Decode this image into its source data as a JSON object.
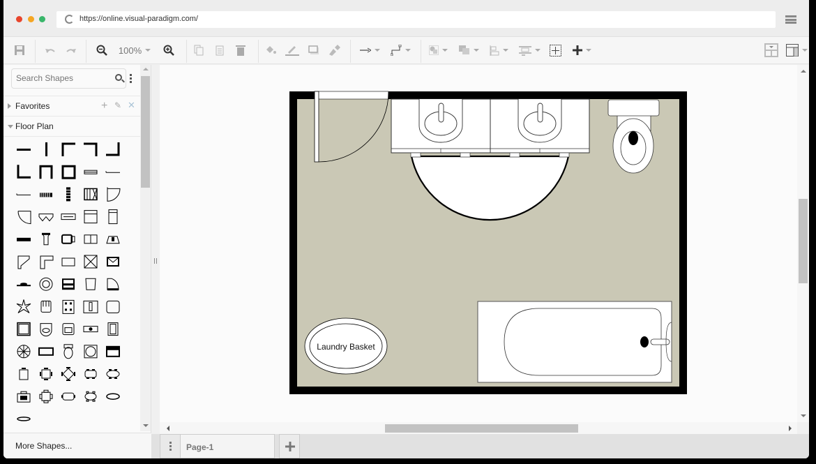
{
  "browser": {
    "url": "https://online.visual-paradigm.com/",
    "traffic_lights": {
      "close": "#e8452c",
      "minimize": "#f5a623",
      "maximize": "#39b66a"
    }
  },
  "toolbar": {
    "zoom_level": "100%",
    "buttons": [
      "save-icon",
      "undo-icon",
      "redo-icon",
      "zoom-out-icon",
      "zoom-in-icon",
      "copy-icon",
      "paste-icon",
      "delete-icon",
      "fill-color-icon",
      "line-color-icon",
      "shadow-icon",
      "format-painter-icon",
      "connector-straight-icon",
      "connector-elbow-icon",
      "arrange-icon",
      "to-front-icon",
      "align-icon",
      "distribute-icon",
      "select-all-icon",
      "insert-icon",
      "panel-layout-icon",
      "sidebar-toggle-icon"
    ]
  },
  "sidebar": {
    "search_placeholder": "Search Shapes",
    "sections": [
      {
        "label": "Favorites",
        "expanded": false
      },
      {
        "label": "Floor Plan",
        "expanded": true
      }
    ],
    "more_shapes": "More Shapes..."
  },
  "diagram": {
    "floor_color": "#cac8b5",
    "wall_color": "#000000",
    "labels": {
      "laundry_basket": "Laundry Basket"
    }
  },
  "pages": {
    "tabs": [
      {
        "label": "Page-1",
        "active": true
      }
    ]
  }
}
